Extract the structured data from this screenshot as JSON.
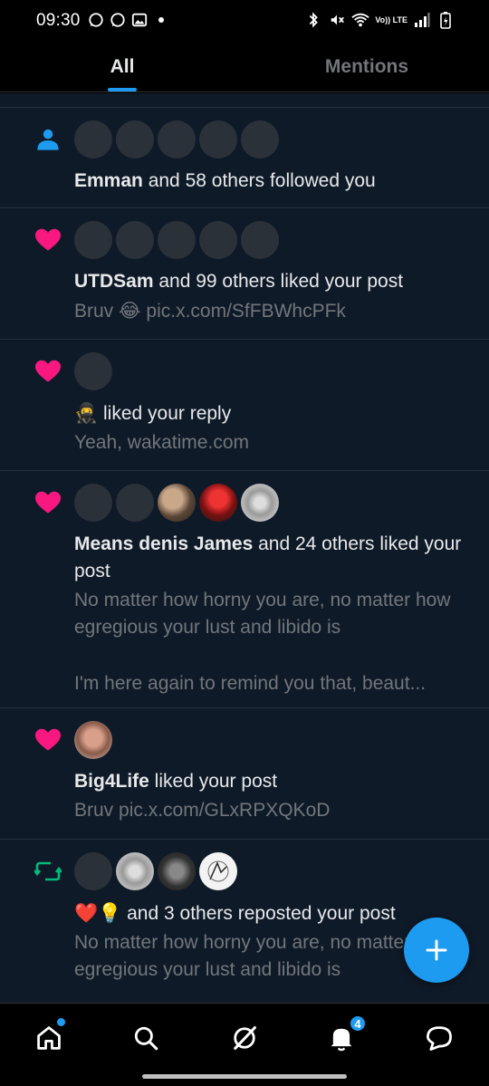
{
  "status_bar": {
    "time": "09:30",
    "network_label": "Vo)) LTE"
  },
  "tabs": [
    {
      "label": "All",
      "active": true
    },
    {
      "label": "Mentions",
      "active": false
    }
  ],
  "notifications": [
    {
      "kind": "follow",
      "actor": "Emman",
      "rest": " and 58 others followed you",
      "sub": ""
    },
    {
      "kind": "like",
      "actor": "UTDSam",
      "rest": " and 99 others liked your post",
      "sub_prefix": "Bruv ",
      "sub_emoji": "😂",
      "sub_suffix": " pic.x.com/SfFBWhcPFk"
    },
    {
      "kind": "like",
      "actor_emoji": "🥷",
      "rest": " liked your reply",
      "sub": "Yeah, wakatime.com"
    },
    {
      "kind": "like",
      "actor": "Means denis James",
      "rest": " and 24 others liked your post",
      "sub1": "No matter how horny you are, no matter how egregious your lust and libido is",
      "sub2": "I'm here again to remind you that, beaut..."
    },
    {
      "kind": "like",
      "actor": "Big4Life",
      "rest": " liked your post",
      "sub": "Bruv pic.x.com/GLxRPXQKoD"
    },
    {
      "kind": "repost",
      "actor_emoji": "❤️💡",
      "rest": " and 3 others reposted your post",
      "sub": "No matter how horny you are, no matter how egregious your lust and libido is"
    }
  ],
  "bottom_nav": {
    "notifications_badge": "4"
  },
  "colors": {
    "accent": "#1d9bf0",
    "like": "#f91880",
    "repost": "#00ba7c",
    "follow": "#1d9bf0"
  }
}
